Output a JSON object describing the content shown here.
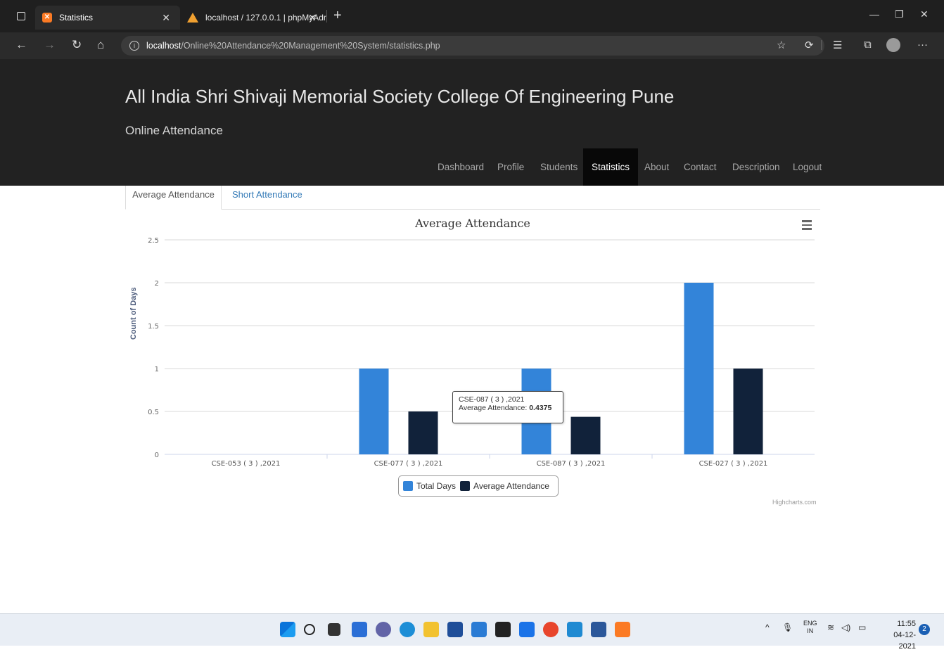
{
  "browser": {
    "tabs": [
      {
        "label": "Statistics"
      },
      {
        "label": "localhost / 127.0.0.1 | phpMyAdr"
      }
    ],
    "url_host": "localhost",
    "url_path": "/Online%20Attendance%20Management%20System/statistics.php"
  },
  "site": {
    "title": "All India Shri Shivaji Memorial Society College Of Engineering Pune",
    "subtitle": "Online Attendance",
    "menu": [
      "Dashboard",
      "Profile",
      "Students",
      "Statistics",
      "About",
      "Contact",
      "Description",
      "Logout"
    ],
    "active_menu": "Statistics"
  },
  "page_tabs": [
    "Average Attendance",
    "Short Attendance"
  ],
  "chart_data": {
    "type": "bar",
    "title": "Average Attendance",
    "xlabel": "",
    "ylabel": "Count of Days",
    "ylim": [
      0,
      2.5
    ],
    "yticks": [
      "0",
      "0.5",
      "1",
      "1.5",
      "2",
      "2.5"
    ],
    "categories": [
      "CSE-053 ( 3 ) ,2021",
      "CSE-077 ( 3 ) ,2021",
      "CSE-087 ( 3 ) ,2021",
      "CSE-027 ( 3 ) ,2021"
    ],
    "series": [
      {
        "name": "Total Days",
        "color": "#3384d9",
        "values": [
          0,
          1,
          1,
          2
        ]
      },
      {
        "name": "Average Attendance",
        "color": "#11223a",
        "values": [
          0,
          0.5,
          0.4375,
          1
        ]
      }
    ],
    "legend": "bottom-center",
    "grid": true,
    "credits": "Highcharts.com",
    "tooltip": {
      "category": "CSE-087 ( 3 ) ,2021",
      "series": "Average Attendance: ",
      "value": "0.4375"
    }
  },
  "taskbar": {
    "lang_line1": "ENG",
    "lang_line2": "IN",
    "time": "11:55",
    "date": "04-12-2021",
    "notifications": "2"
  }
}
